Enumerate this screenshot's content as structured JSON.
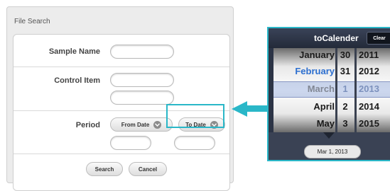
{
  "form": {
    "title": "File Search",
    "sample_name_label": "Sample Name",
    "control_item_label": "Control Item",
    "period_label": "Period",
    "from_date_label": "From Date",
    "to_date_label": "To Date",
    "search_label": "Search",
    "cancel_label": "Cancel"
  },
  "calendar": {
    "title": "toCalender",
    "clear_label": "Clear",
    "months": [
      "January",
      "February",
      "March",
      "April",
      "May"
    ],
    "days": [
      "30",
      "31",
      "1",
      "2",
      "3"
    ],
    "years": [
      "2011",
      "2012",
      "2013",
      "2014",
      "2015"
    ],
    "selected_date": "Mar 1, 2013"
  },
  "colors": {
    "highlight": "#2ab7c8",
    "selected_text": "#2c6fd0"
  }
}
